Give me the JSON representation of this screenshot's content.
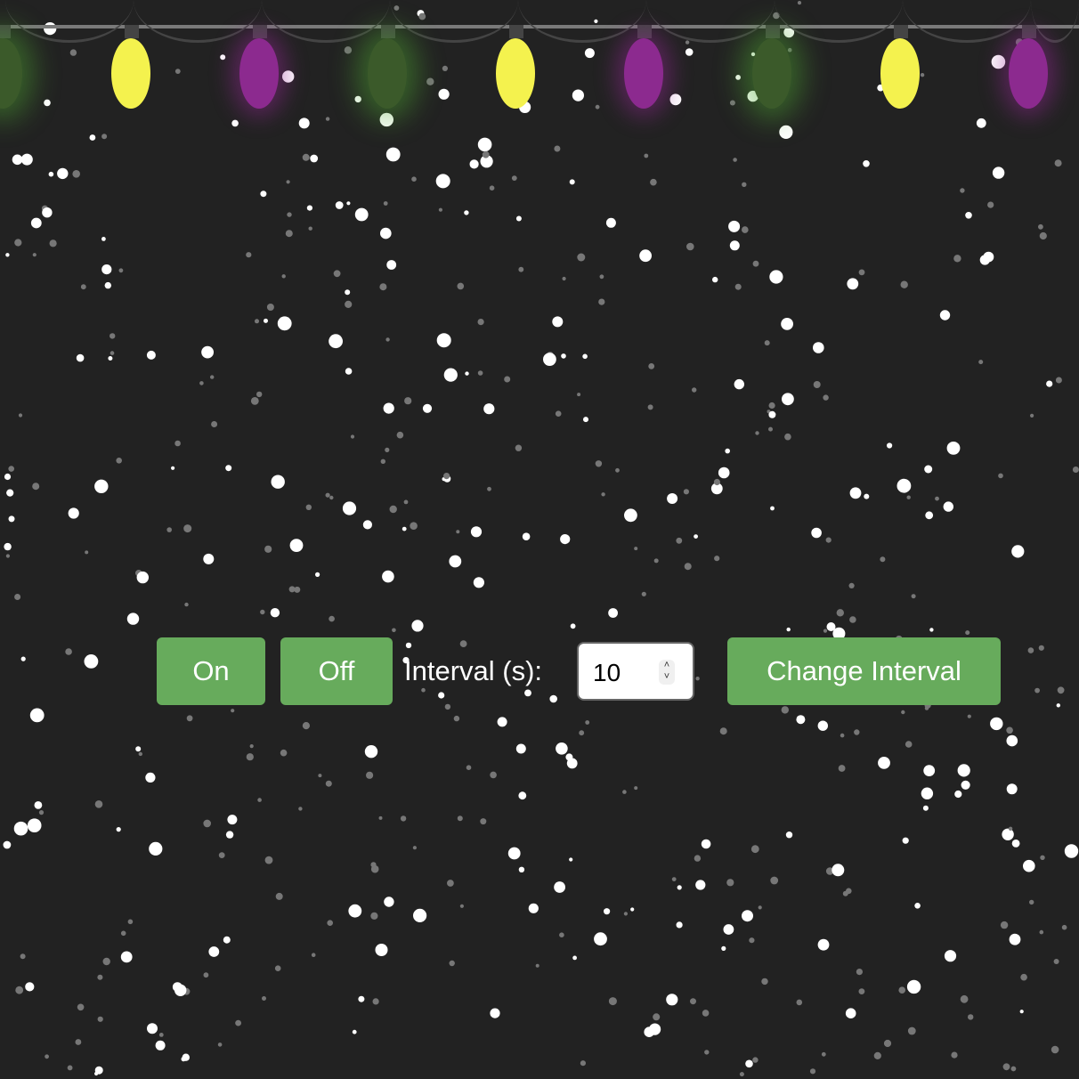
{
  "lights": {
    "colors": {
      "green": "#3b5a2a",
      "yellow": "#f4f24e",
      "purple": "#8c2a8f"
    },
    "sequence": [
      "green",
      "yellow",
      "purple",
      "green",
      "yellow",
      "purple",
      "green",
      "yellow",
      "purple"
    ]
  },
  "controls": {
    "on_label": "On",
    "off_label": "Off",
    "interval_label": "Interval (s):",
    "interval_value": "10",
    "change_label": "Change Interval"
  }
}
